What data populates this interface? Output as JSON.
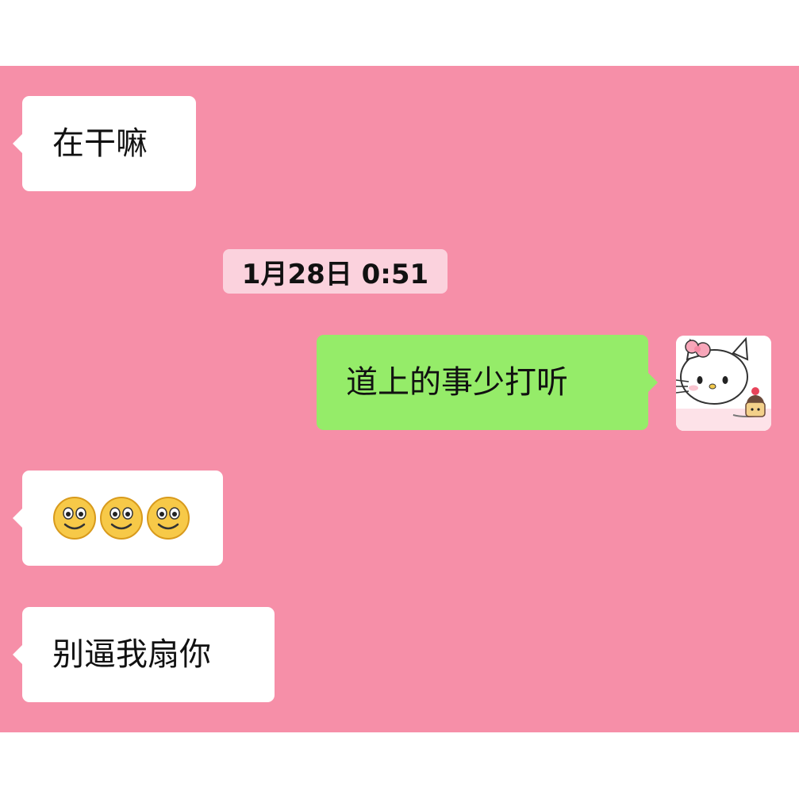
{
  "chat": {
    "background_color": "#f68fa8",
    "messages": [
      {
        "side": "left",
        "text": "在干嘛"
      },
      {
        "type": "timestamp",
        "text": "1月28日 0:51"
      },
      {
        "side": "right",
        "text": "道上的事少打听",
        "avatar_icon": "hello-kitty-avatar"
      },
      {
        "side": "left",
        "emojis": [
          "smile-emoji",
          "smile-emoji",
          "smile-emoji"
        ]
      },
      {
        "side": "left",
        "text": "别逼我扇你"
      }
    ]
  },
  "colors": {
    "incoming_bubble": "#ffffff",
    "outgoing_bubble": "#95ec69",
    "timestamp_bg": "#fbd2dd"
  }
}
